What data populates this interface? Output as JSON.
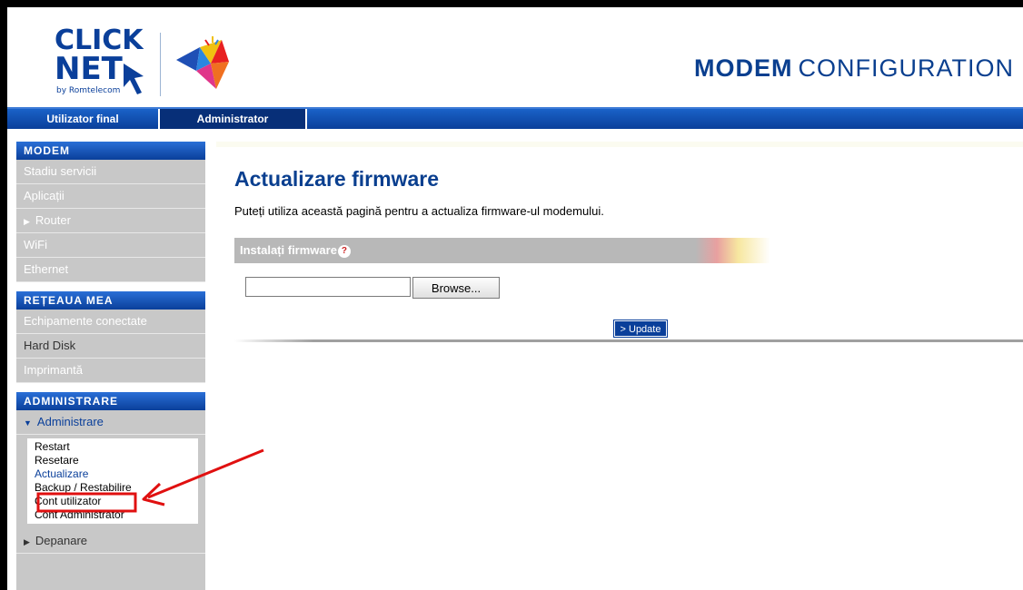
{
  "header": {
    "logo_text_1": "CLICK",
    "logo_text_2": "NET",
    "logo_text_3": "by Romtelecom",
    "title_bold": "MODEM",
    "title_rest": "CONFIGURATION"
  },
  "tabs": [
    {
      "label": "Utilizator final"
    },
    {
      "label": "Administrator"
    }
  ],
  "sidebar": {
    "sections": [
      {
        "title": "MODEM",
        "items": [
          "Stadiu servicii",
          "Aplicații",
          "Router",
          "WiFi",
          "Ethernet"
        ]
      },
      {
        "title": "REȚEAUA MEA",
        "items": [
          "Echipamente conectate",
          "Hard Disk",
          "Imprimantă"
        ]
      },
      {
        "title": "ADMINISTRARE",
        "expanded_label": "Administrare",
        "subitems": [
          "Restart",
          "Resetare",
          "Actualizare",
          "Backup / Restabilire",
          "Cont utilizator",
          "Cont Administrator"
        ],
        "after_label": "Depanare"
      }
    ]
  },
  "main": {
    "title": "Actualizare firmware",
    "description": "Puteți utiliza această pagină pentru a actualiza firmware-ul modemului.",
    "section_label": "Instalați firmware",
    "help_glyph": "?",
    "file_value": "",
    "browse_label": "Browse...",
    "update_label": "> Update"
  },
  "colors": {
    "brand_blue": "#0a3f9a",
    "annotation_red": "#e01010"
  },
  "icons": [
    "clicknet-logo",
    "arrow-cursor-icon",
    "bird-logo",
    "triangle-right-icon",
    "triangle-down-icon",
    "help-icon"
  ]
}
